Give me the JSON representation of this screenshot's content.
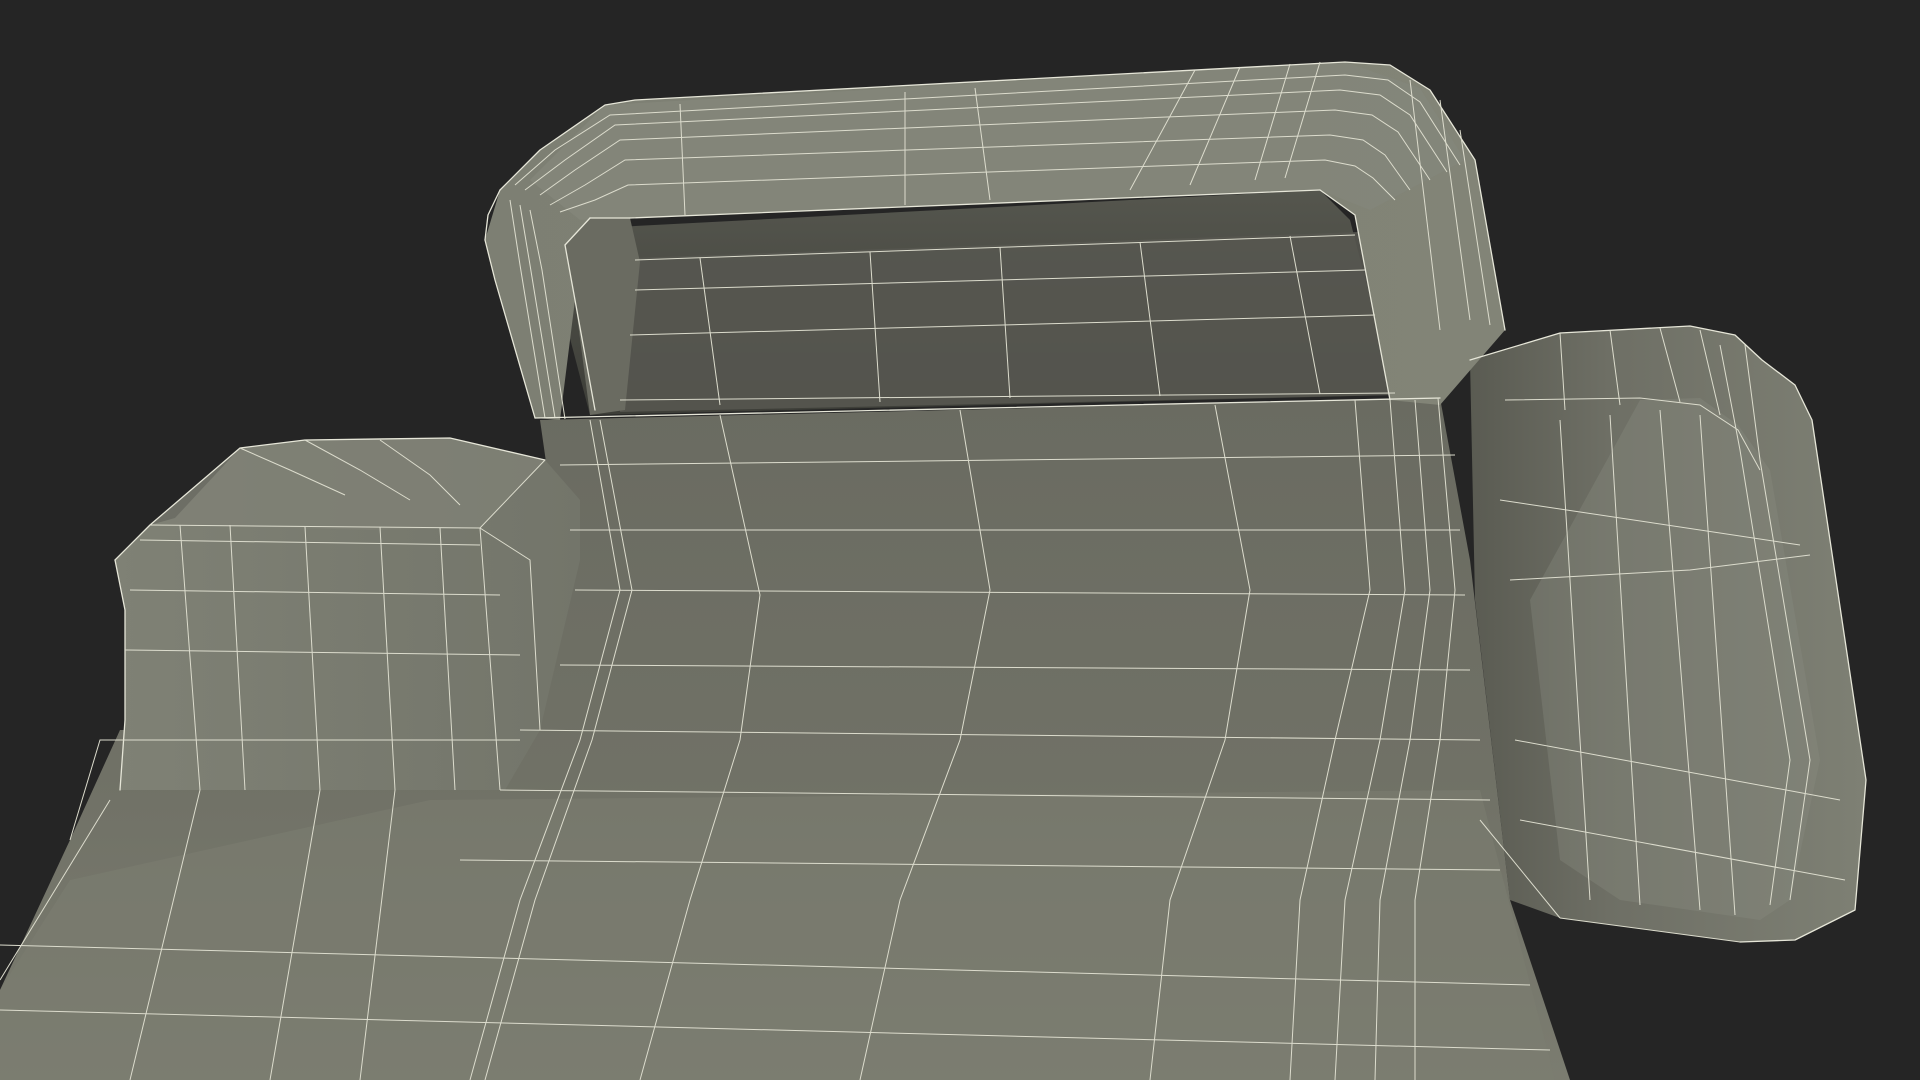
{
  "scene": {
    "kind": "wireframe-render",
    "background_color": "#252525",
    "surface_color": "#75766b",
    "surface_dark_color": "#5d5e55",
    "surface_light_color": "#84867a",
    "wire_color": "#e6e6d8"
  }
}
